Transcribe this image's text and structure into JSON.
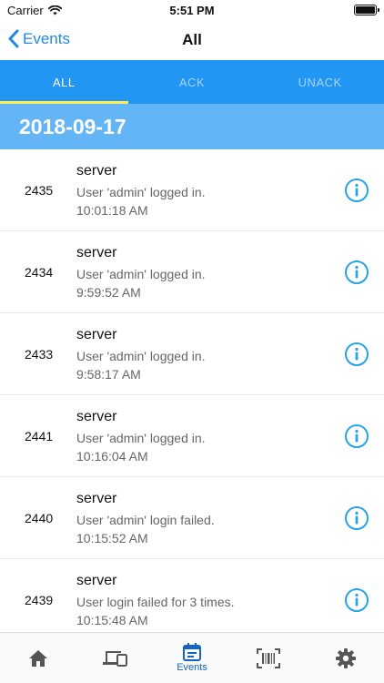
{
  "status_bar": {
    "carrier": "Carrier",
    "time": "5:51 PM"
  },
  "nav": {
    "back_label": "Events",
    "title": "All"
  },
  "tabs": [
    {
      "label": "ALL"
    },
    {
      "label": "ACK"
    },
    {
      "label": "UNACK"
    }
  ],
  "section": {
    "date": "2018-09-17"
  },
  "events": [
    {
      "id": "2435",
      "source": "server",
      "message": "User 'admin' logged in.",
      "time": "10:01:18 AM"
    },
    {
      "id": "2434",
      "source": "server",
      "message": "User 'admin' logged in.",
      "time": "9:59:52 AM"
    },
    {
      "id": "2433",
      "source": "server",
      "message": "User 'admin' logged in.",
      "time": "9:58:17 AM"
    },
    {
      "id": "2441",
      "source": "server",
      "message": "User 'admin' logged in.",
      "time": "10:16:04 AM"
    },
    {
      "id": "2440",
      "source": "server",
      "message": "User 'admin' login failed.",
      "time": "10:15:52 AM"
    },
    {
      "id": "2439",
      "source": "server",
      "message": "User login failed for 3 times.",
      "time": "10:15:48 AM"
    }
  ],
  "tabbar": {
    "events_label": "Events"
  },
  "colors": {
    "accent": "#2196f3",
    "section": "#64b5f6",
    "indicator": "#ffee58",
    "tabbar_active": "#1565c0",
    "tabbar_inactive": "#555555"
  },
  "icons": {
    "status_bar": [
      "wifi-icon",
      "battery-icon"
    ],
    "nav": "chevron-left-icon",
    "row": "info-icon",
    "tabbar": [
      "home-icon",
      "devices-icon",
      "calendar-icon",
      "barcode-icon",
      "gear-icon"
    ]
  }
}
